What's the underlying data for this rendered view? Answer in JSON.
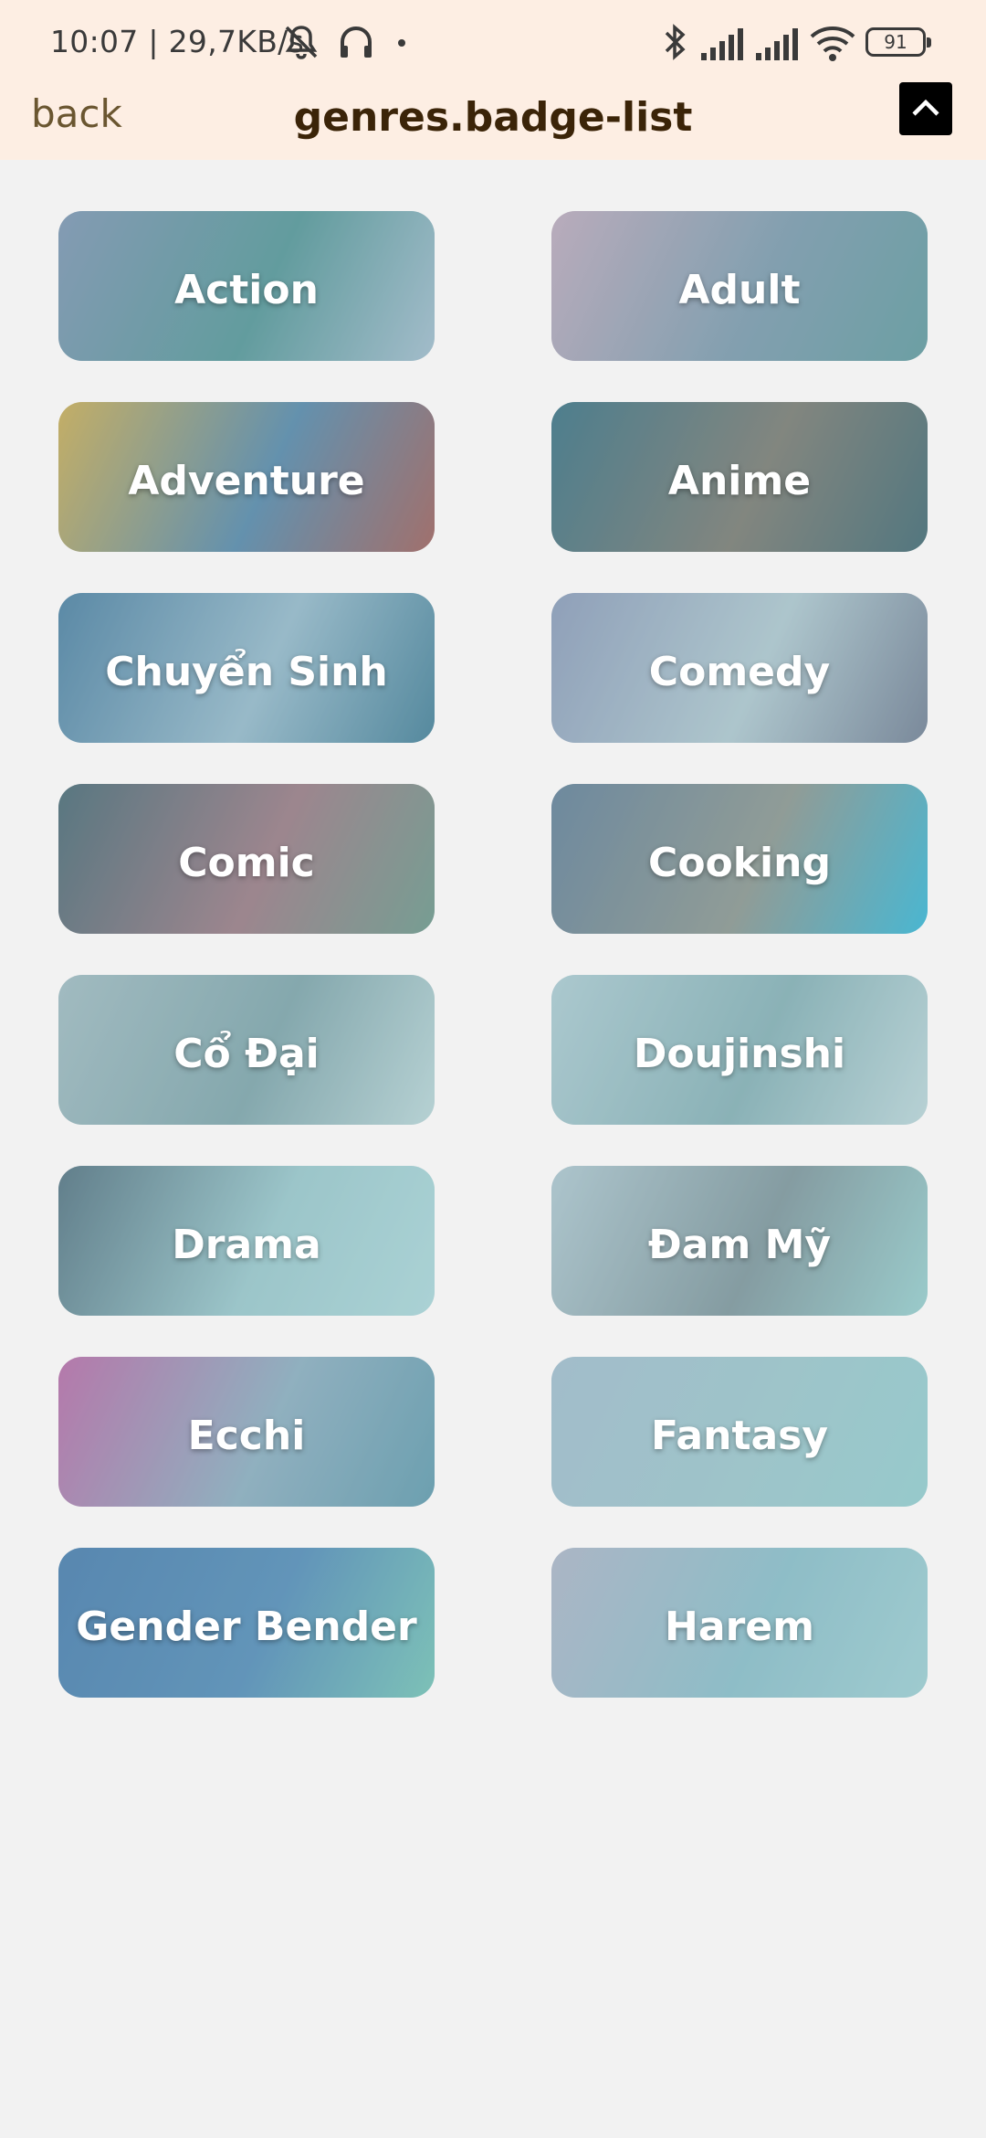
{
  "status_bar": {
    "time_speed": "10:07 | 29,7KB/s",
    "battery": "91",
    "icons": [
      "muted-bell-icon",
      "headset-icon",
      "dot-icon",
      "bluetooth-icon",
      "signal-icon",
      "signal-icon",
      "wifi-icon",
      "battery-icon"
    ]
  },
  "header": {
    "back_label": "back",
    "title": "genres.badge-list",
    "scroll_top_icon": "chevron-up-icon"
  },
  "genres": [
    {
      "name": "Action",
      "bg": [
        "#7d88a8",
        "#4d8a8a",
        "#a9b8c9"
      ]
    },
    {
      "name": "Adult",
      "bg": [
        "#c9a0b4",
        "#7b8fa3",
        "#5b8f92"
      ]
    },
    {
      "name": "Adventure",
      "bg": [
        "#d8a43a",
        "#4f7aa0",
        "#a64b43"
      ]
    },
    {
      "name": "Anime",
      "bg": [
        "#2f5f72",
        "#7a6a5e",
        "#37555e"
      ]
    },
    {
      "name": "Chuyển Sinh",
      "bg": [
        "#426f95",
        "#9ab4c6",
        "#3a6f8a"
      ]
    },
    {
      "name": "Comedy",
      "bg": [
        "#8d8fb0",
        "#b8c5cc",
        "#6f6f85"
      ]
    },
    {
      "name": "Comic",
      "bg": [
        "#3f5560",
        "#a06a73",
        "#6a8c7a"
      ]
    },
    {
      "name": "Cooking",
      "bg": [
        "#5d6f8a",
        "#8e8a80",
        "#2ab0d3"
      ]
    },
    {
      "name": "Cổ Đại",
      "bg": [
        "#a7b6bb",
        "#7e9ba0",
        "#c5d6d6"
      ]
    },
    {
      "name": "Doujinshi",
      "bg": [
        "#b5c9cf",
        "#86a9ad",
        "#c7d6d8"
      ]
    },
    {
      "name": "Drama",
      "bg": [
        "#4b5f6e",
        "#9fc5c8",
        "#b4d7d8"
      ]
    },
    {
      "name": "Đam Mỹ",
      "bg": [
        "#b7c4cc",
        "#7e8a8f",
        "#9dcdca"
      ]
    },
    {
      "name": "Ecchi",
      "bg": [
        "#c3579c",
        "#8ea6b9",
        "#5b8fa3"
      ]
    },
    {
      "name": "Fantasy",
      "bg": [
        "#a8b8c9",
        "#a2c3c8",
        "#98cbcb"
      ]
    },
    {
      "name": "Gender Bender",
      "bg": [
        "#3e6ca3",
        "#4c7fb0",
        "#73bfae"
      ]
    },
    {
      "name": "Harem",
      "bg": [
        "#b5aec2",
        "#8cb9c4",
        "#a3cdd0"
      ]
    }
  ]
}
